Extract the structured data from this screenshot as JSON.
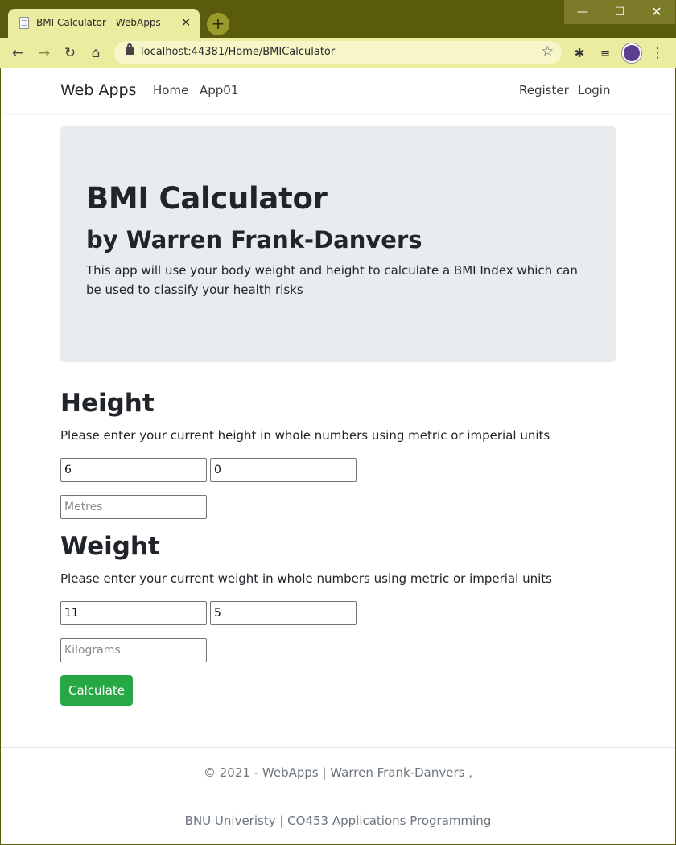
{
  "browser": {
    "tab_title": "BMI Calculator - WebApps",
    "tab_close": "✕",
    "new_tab": "+",
    "url": "localhost:44381/Home/BMICalculator",
    "frame_color": "#5b5b0e",
    "toolbar_color": "#ececa0",
    "window_controls": {
      "minimize": "—",
      "maximize": "☐",
      "close": "✕"
    }
  },
  "navbar": {
    "brand": "Web Apps",
    "links": [
      {
        "label": "Home"
      },
      {
        "label": "App01"
      }
    ],
    "right_links": [
      {
        "label": "Register"
      },
      {
        "label": "Login"
      }
    ]
  },
  "jumbotron": {
    "title": "BMI Calculator",
    "subtitle": "by Warren Frank-Danvers",
    "description": "This app will use your body weight and height to calculate a BMI Index which can be used to classify your health risks"
  },
  "height": {
    "title": "Height",
    "description": "Please enter your current height in whole numbers using metric or imperial units",
    "feet_value": "6",
    "inches_value": "0",
    "metres_placeholder": "Metres"
  },
  "weight": {
    "title": "Weight",
    "description": "Please enter your current weight in whole numbers using metric or imperial units",
    "stones_value": "11",
    "pounds_value": "5",
    "kilograms_placeholder": "Kilograms"
  },
  "calculate_button": {
    "label": "Calculate",
    "color": "#28a745"
  },
  "footer": {
    "line1": "© 2021 - WebApps | Warren Frank-Danvers ,",
    "line2": "BNU Univeristy | CO453 Applications Programming"
  }
}
